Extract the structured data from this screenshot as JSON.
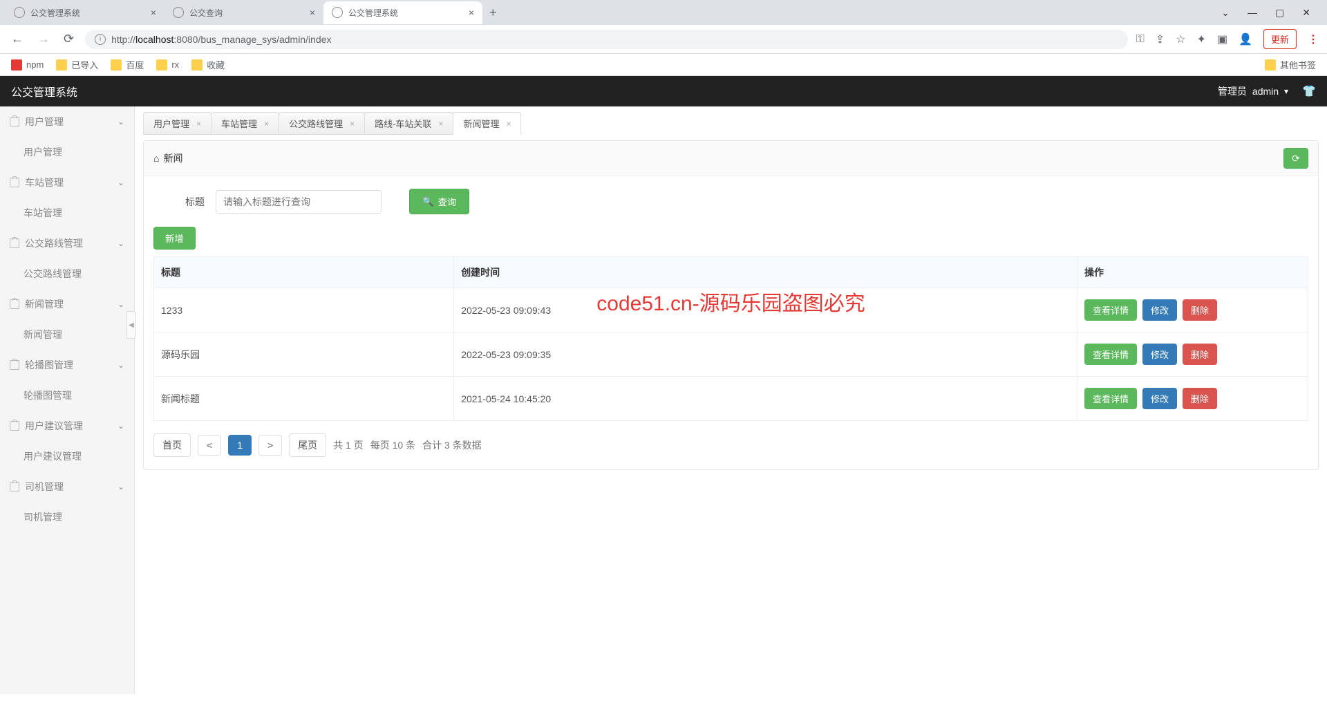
{
  "browser": {
    "tabs": [
      {
        "title": "公交管理系统",
        "active": false
      },
      {
        "title": "公交查询",
        "active": false
      },
      {
        "title": "公交管理系统",
        "active": true
      }
    ],
    "url_prefix": "http://",
    "url_host": "localhost",
    "url_port": ":8080",
    "url_path": "/bus_manage_sys/admin/index",
    "update_label": "更新",
    "window": {
      "min": "—",
      "max": "▢",
      "close": "✕",
      "down": "⌄"
    }
  },
  "bookmarks": {
    "items": [
      "npm",
      "已导入",
      "百度",
      "rx",
      "收藏"
    ],
    "other": "其他书签"
  },
  "header": {
    "title": "公交管理系统",
    "role": "管理员",
    "user": "admin"
  },
  "sidebar": [
    {
      "label": "用户管理",
      "children": [
        "用户管理"
      ]
    },
    {
      "label": "车站管理",
      "children": [
        "车站管理"
      ]
    },
    {
      "label": "公交路线管理",
      "children": [
        "公交路线管理"
      ]
    },
    {
      "label": "新闻管理",
      "children": [
        "新闻管理"
      ]
    },
    {
      "label": "轮播图管理",
      "children": [
        "轮播图管理"
      ]
    },
    {
      "label": "用户建议管理",
      "children": [
        "用户建议管理"
      ]
    },
    {
      "label": "司机管理",
      "children": [
        "司机管理"
      ]
    }
  ],
  "content_tabs": [
    {
      "label": "用户管理",
      "closable": true,
      "active": false
    },
    {
      "label": "车站管理",
      "closable": true,
      "active": false
    },
    {
      "label": "公交路线管理",
      "closable": true,
      "active": false
    },
    {
      "label": "路线-车站关联",
      "closable": true,
      "active": false
    },
    {
      "label": "新闻管理",
      "closable": true,
      "active": true
    }
  ],
  "panel": {
    "breadcrumb": "新闻",
    "search_label": "标题",
    "search_placeholder": "请输入标题进行查询",
    "search_btn": "查询",
    "add_btn": "新增"
  },
  "table": {
    "columns": [
      "标题",
      "创建时间",
      "操作"
    ],
    "rows": [
      {
        "title": "1233",
        "time": "2022-05-23 09:09:43"
      },
      {
        "title": "源码乐园",
        "time": "2022-05-23 09:09:35"
      },
      {
        "title": "新闻标题",
        "time": "2021-05-24 10:45:20"
      }
    ],
    "actions": {
      "view": "查看详情",
      "edit": "修改",
      "delete": "删除"
    }
  },
  "pagination": {
    "first": "首页",
    "prev": "<",
    "page": "1",
    "next": ">",
    "last": "尾页",
    "summary_pages": "共 1 页",
    "summary_per": "每页 10 条",
    "summary_total": "合计 3 条数据"
  },
  "watermark": "code51.cn-源码乐园盗图必究"
}
